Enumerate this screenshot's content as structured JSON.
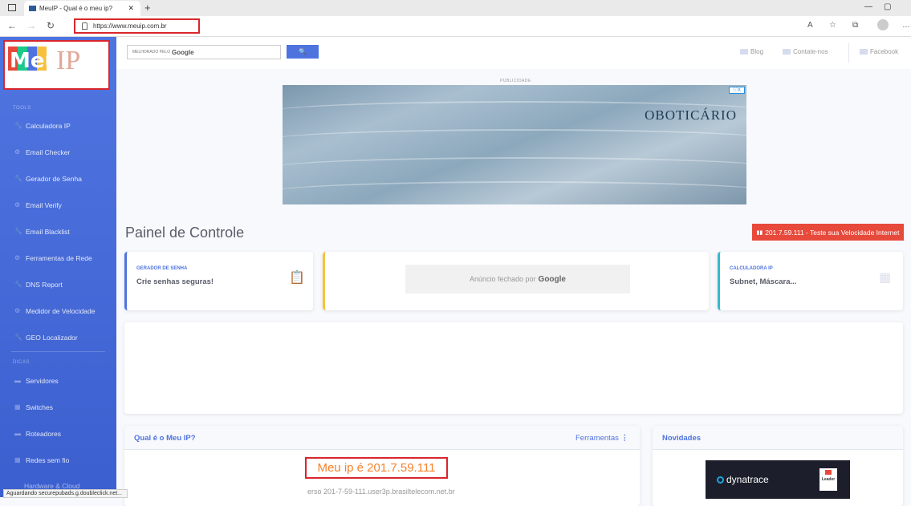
{
  "browser": {
    "tab_title": "MeuIP - Qual é o meu ip?",
    "new_tab": "+",
    "url": "https://www.meuip.com.br",
    "status_text": "Aguardando securepubads.g.doubleclick.net..."
  },
  "sidebar": {
    "active_label": "Meu IP",
    "tools_heading": "TOOLS",
    "tools": [
      {
        "label": "Calculadora IP",
        "icon": "wrench-icon"
      },
      {
        "label": "Email Checker",
        "icon": "cog-icon"
      },
      {
        "label": "Gerador de Senha",
        "icon": "wrench-icon"
      },
      {
        "label": "Email Verify",
        "icon": "cog-icon"
      },
      {
        "label": "Email Blacklist",
        "icon": "wrench-icon"
      },
      {
        "label": "Ferramentas de Rede",
        "icon": "cog-icon"
      },
      {
        "label": "DNS Report",
        "icon": "wrench-icon"
      },
      {
        "label": "Medidor de Velocidade",
        "icon": "cog-icon"
      },
      {
        "label": "GEO Localizador",
        "icon": "wrench-icon"
      }
    ],
    "tips_heading": "DICAS",
    "tips": [
      {
        "label": "Servidores",
        "icon": "folder-icon"
      },
      {
        "label": "Switches",
        "icon": "table-icon"
      },
      {
        "label": "Roteadores",
        "icon": "folder-icon"
      },
      {
        "label": "Redes sem fio",
        "icon": "table-icon"
      }
    ],
    "partial_item": "Hardware & Cloud"
  },
  "topbar": {
    "search_prefix": "MELHORADO PELO",
    "search_brand": "Google",
    "search_button": "🔍",
    "links": [
      "Blog",
      "Contate-nos",
      "Facebook"
    ]
  },
  "ad": {
    "label": "PUBLICIDADE",
    "brand": "OBOTICÁRIO",
    "adchoices": "ⓘX"
  },
  "main": {
    "title": "Painel de Controle",
    "speed_button": "201.7.59.111 - Teste sua Velocidade Internet",
    "card_password": {
      "kicker": "GERADOR DE SENHA",
      "value": "Crie senhas seguras!"
    },
    "ad_closed": {
      "text": "Anúncio fechado por",
      "brand": "Google"
    },
    "card_calc": {
      "kicker": "CALCULADORA IP",
      "value": "Subnet, Máscara..."
    },
    "ip_panel": {
      "heading": "Qual é o Meu IP?",
      "tools_link": "Ferramentas",
      "my_ip": "Meu ip é 201.7.59.111",
      "reverse": "erso 201-7-59-111.user3p.brasiltelecom.net.br"
    },
    "news_panel": {
      "heading": "Novidades",
      "ad_brand": "dynatrace",
      "ad_badge": "Leader"
    }
  },
  "colors": {
    "primary": "#4e73df",
    "danger": "#e74a3b",
    "warning": "#f6c23e",
    "info": "#36b9cc",
    "highlight_ip": "#f6822c"
  }
}
